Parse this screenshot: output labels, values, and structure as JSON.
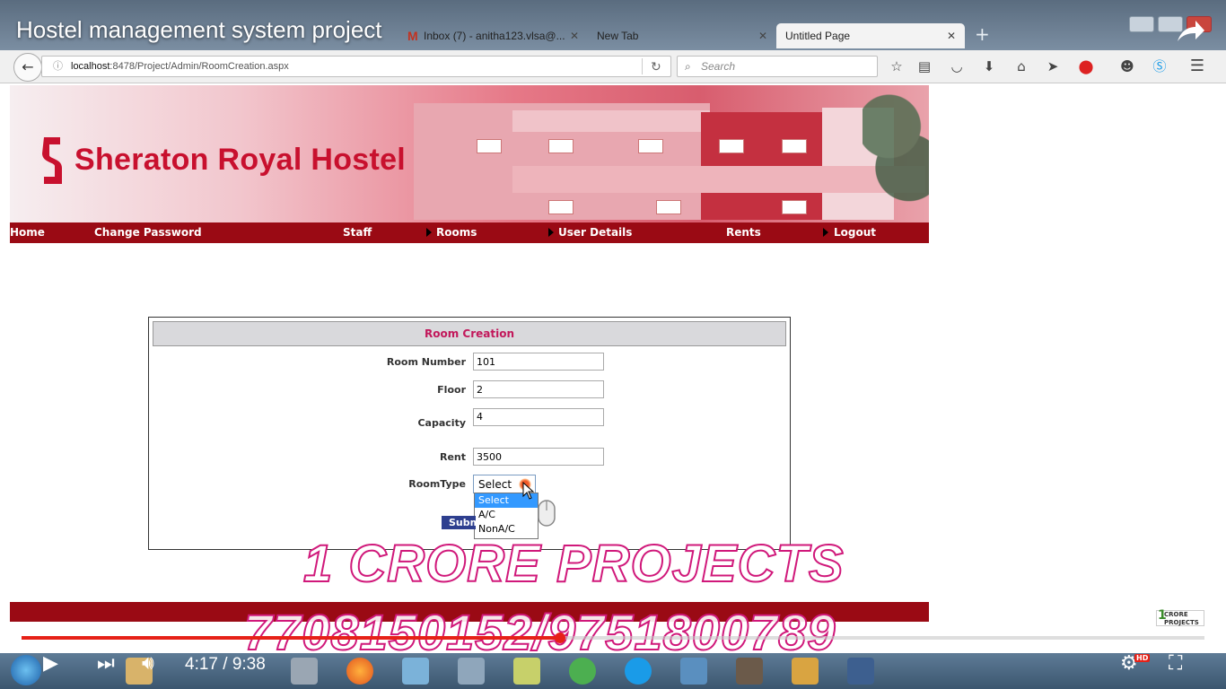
{
  "video": {
    "title": "Hostel management system project",
    "time": "4:17 / 9:38",
    "progress": 0.455,
    "quality_badge": "HD"
  },
  "browser": {
    "tabs": [
      {
        "label": "Inbox (7) - anitha123.vlsa@...",
        "icon": "gmail-icon"
      },
      {
        "label": "New Tab"
      },
      {
        "label": "Untitled Page",
        "active": true
      }
    ],
    "url_host": "localhost",
    "url_path": ":8478/Project/Admin/RoomCreation.aspx",
    "search_placeholder": "Search"
  },
  "site": {
    "name": "Sheraton Royal Hostel",
    "menu": [
      "Home",
      "Change Password",
      "Staff",
      "Rooms",
      "User Details",
      "Rents",
      "Logout"
    ]
  },
  "form": {
    "title": "Room Creation",
    "fields": {
      "room_number": {
        "label": "Room Number",
        "value": "101"
      },
      "floor": {
        "label": "Floor",
        "value": "2"
      },
      "capacity": {
        "label": "Capacity",
        "value": "4"
      },
      "rent": {
        "label": "Rent",
        "value": "3500"
      },
      "room_type": {
        "label": "RoomType",
        "value": "Select",
        "options": [
          "Select",
          "A/C",
          "NonA/C"
        ]
      }
    },
    "submit_label": "Submit"
  },
  "watermark": {
    "line1": "1 CRORE PROJECTS",
    "line2": "7708150152/9751800789",
    "logo_text_1": "CRORE",
    "logo_text_2": "PROJECTS"
  },
  "colors": {
    "brand_red": "#c8102e",
    "menu_bg": "#9a0a14",
    "form_title": "#c2185b",
    "progress": "#e62117"
  }
}
